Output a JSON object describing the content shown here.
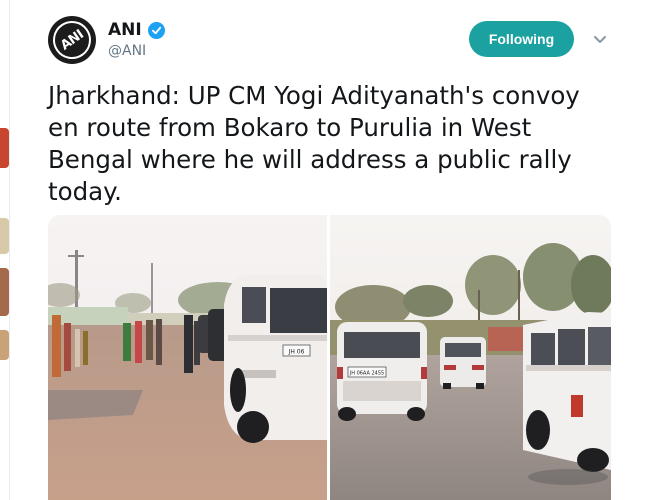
{
  "tweet": {
    "author": {
      "display_name": "ANI",
      "handle": "@ANI",
      "verified": true,
      "avatar_logo": "ANI"
    },
    "follow_button_label": "Following",
    "text": "Jharkhand: UP CM Yogi Adityanath's convoy en route from Bokaro to Purulia in West Bengal where he will address a public rally today.",
    "media": {
      "left_plate_text": "JH 06",
      "right_plate_text": "JH 06AA 2455"
    }
  },
  "colors": {
    "follow_button": "#1ca1a1",
    "verified_badge": "#1da1f2",
    "handle_gray": "#657786"
  },
  "icons": {
    "verified": "verified-badge-icon",
    "caret": "chevron-down-icon"
  }
}
